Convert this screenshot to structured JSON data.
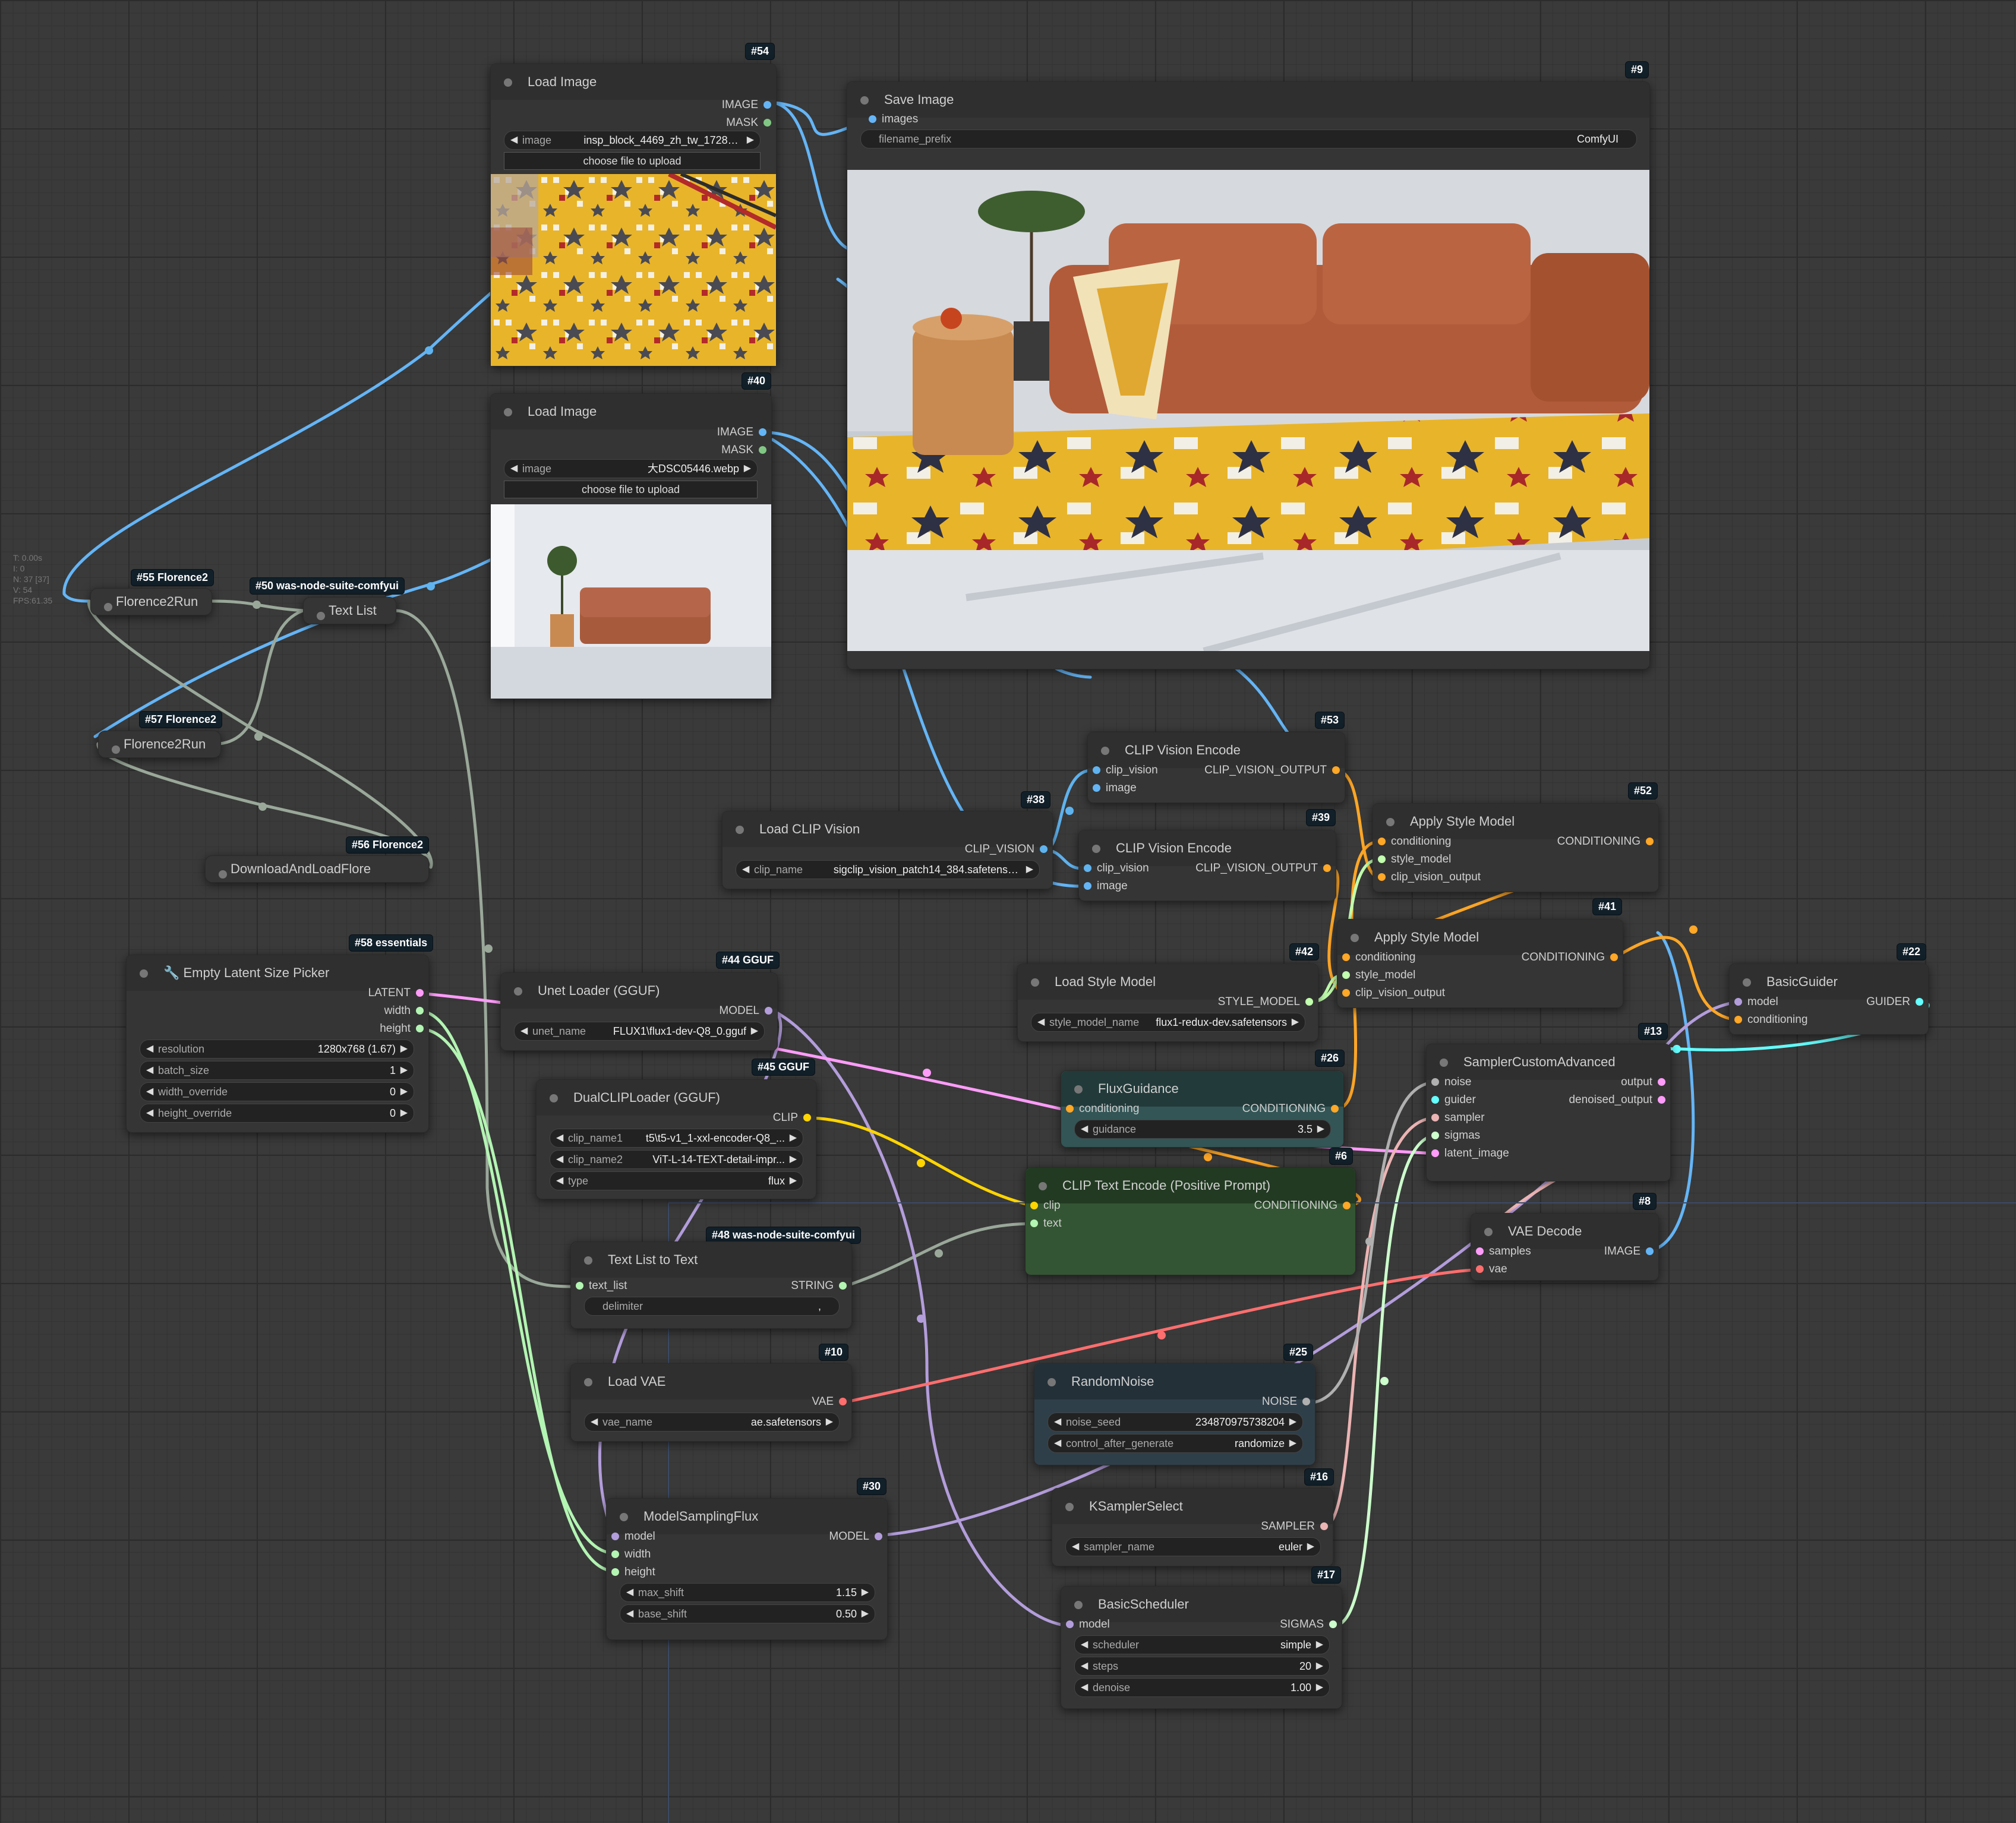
{
  "colors": {
    "clip_vision": "#5fb3ef",
    "image": "#64b5f6",
    "model": "#b39ddb",
    "conditioning": "#ffa726",
    "latent": "#ff9cf9",
    "vae": "#ff6e6e",
    "clip": "#ffd500",
    "int": "#b3f5b3",
    "string": "#9aa89a",
    "guider": "#66ffff",
    "sampler": "#ecb4b4",
    "sigmas": "#cdffcd",
    "noise": "#b0b0b0",
    "style_model": "#c2ffae",
    "mask": "#81c784"
  },
  "stats": [
    "T: 0.00s",
    "I: 0",
    "N: 37 [37]",
    "V: 54",
    "FPS:61.35"
  ],
  "nodes": {
    "load_image_54": {
      "badge": "#54",
      "title": "Load Image",
      "out_image": "IMAGE",
      "out_mask": "MASK",
      "widget_label": "image",
      "widget_value": "insp_block_4469_zh_tw_1728358...",
      "upload": "choose file to upload"
    },
    "load_image_40": {
      "badge": "#40",
      "title": "Load Image",
      "out_image": "IMAGE",
      "out_mask": "MASK",
      "widget_label": "image",
      "widget_value": "大DSC05446.webp",
      "upload": "choose file to upload"
    },
    "save_image_9": {
      "badge": "#9",
      "title": "Save Image",
      "in_images": "images",
      "widget_label": "filename_prefix",
      "widget_value": "ComfyUI"
    },
    "florence_55": {
      "badge": "#55 Florence2",
      "title": "Florence2Run"
    },
    "text_list_50": {
      "badge": "#50 was-node-suite-comfyui",
      "title": "Text List"
    },
    "florence_57": {
      "badge": "#57 Florence2",
      "title": "Florence2Run"
    },
    "download_56": {
      "badge": "#56 Florence2",
      "title": "DownloadAndLoadFlore"
    },
    "empty_latent_58": {
      "badge": "#58 essentials",
      "title": "🔧 Empty Latent Size Picker",
      "out_latent": "LATENT",
      "out_width": "width",
      "out_height": "height",
      "widgets": [
        {
          "label": "resolution",
          "value": "1280x768 (1.67)"
        },
        {
          "label": "batch_size",
          "value": "1"
        },
        {
          "label": "width_override",
          "value": "0"
        },
        {
          "label": "height_override",
          "value": "0"
        }
      ]
    },
    "unet_44": {
      "badge": "#44 GGUF",
      "title": "Unet Loader (GGUF)",
      "out_model": "MODEL",
      "widget_label": "unet_name",
      "widget_value": "FLUX1\\flux1-dev-Q8_0.gguf"
    },
    "dualclip_45": {
      "badge": "#45 GGUF",
      "title": "DualCLIPLoader (GGUF)",
      "out_clip": "CLIP",
      "widgets": [
        {
          "label": "clip_name1",
          "value": "t5\\t5-v1_1-xxl-encoder-Q8_..."
        },
        {
          "label": "clip_name2",
          "value": "ViT-L-14-TEXT-detail-impr..."
        },
        {
          "label": "type",
          "value": "flux"
        }
      ]
    },
    "text_list_to_text_48": {
      "badge": "#48 was-node-suite-comfyui",
      "title": "Text List to Text",
      "in_text_list": "text_list",
      "out_string": "STRING",
      "widget_label": "delimiter",
      "widget_value": ","
    },
    "load_vae_10": {
      "badge": "#10",
      "title": "Load VAE",
      "out_vae": "VAE",
      "widget_label": "vae_name",
      "widget_value": "ae.safetensors"
    },
    "model_sampling_30": {
      "badge": "#30",
      "title": "ModelSamplingFlux",
      "in_model": "model",
      "in_width": "width",
      "in_height": "height",
      "out_model": "MODEL",
      "widgets": [
        {
          "label": "max_shift",
          "value": "1.15"
        },
        {
          "label": "base_shift",
          "value": "0.50"
        }
      ]
    },
    "load_clip_vision_38": {
      "badge": "#38",
      "title": "Load CLIP Vision",
      "out_clip_vision": "CLIP_VISION",
      "widget_label": "clip_name",
      "widget_value": "sigclip_vision_patch14_384.safetensors"
    },
    "clip_vision_53": {
      "badge": "#53",
      "title": "CLIP Vision Encode",
      "in_clip_vision": "clip_vision",
      "in_image": "image",
      "out": "CLIP_VISION_OUTPUT"
    },
    "clip_vision_39": {
      "badge": "#39",
      "title": "CLIP Vision Encode",
      "in_clip_vision": "clip_vision",
      "in_image": "image",
      "out": "CLIP_VISION_OUTPUT"
    },
    "load_style_42": {
      "badge": "#42",
      "title": "Load Style Model",
      "out_style": "STYLE_MODEL",
      "widget_label": "style_model_name",
      "widget_value": "flux1-redux-dev.safetensors"
    },
    "flux_guidance_26": {
      "badge": "#26",
      "title": "FluxGuidance",
      "in_conditioning": "conditioning",
      "out_conditioning": "CONDITIONING",
      "widget_label": "guidance",
      "widget_value": "3.5"
    },
    "clip_text_6": {
      "badge": "#6",
      "title": "CLIP Text Encode (Positive Prompt)",
      "in_clip": "clip",
      "in_text": "text",
      "out_conditioning": "CONDITIONING"
    },
    "random_noise_25": {
      "badge": "#25",
      "title": "RandomNoise",
      "out_noise": "NOISE",
      "widgets": [
        {
          "label": "noise_seed",
          "value": "234870975738204"
        },
        {
          "label": "control_after_generate",
          "value": "randomize"
        }
      ]
    },
    "ksampler_select_16": {
      "badge": "#16",
      "title": "KSamplerSelect",
      "out_sampler": "SAMPLER",
      "widget_label": "sampler_name",
      "widget_value": "euler"
    },
    "basic_scheduler_17": {
      "badge": "#17",
      "title": "BasicScheduler",
      "in_model": "model",
      "out_sigmas": "SIGMAS",
      "widgets": [
        {
          "label": "scheduler",
          "value": "simple"
        },
        {
          "label": "steps",
          "value": "20"
        },
        {
          "label": "denoise",
          "value": "1.00"
        }
      ]
    },
    "apply_style_52": {
      "badge": "#52",
      "title": "Apply Style Model",
      "in_conditioning": "conditioning",
      "in_style_model": "style_model",
      "in_clip_vision_output": "clip_vision_output",
      "out_conditioning": "CONDITIONING"
    },
    "apply_style_41": {
      "badge": "#41",
      "title": "Apply Style Model",
      "in_conditioning": "conditioning",
      "in_style_model": "style_model",
      "in_clip_vision_output": "clip_vision_output",
      "out_conditioning": "CONDITIONING"
    },
    "basic_guider_22": {
      "badge": "#22",
      "title": "BasicGuider",
      "in_model": "model",
      "in_conditioning": "conditioning",
      "out_guider": "GUIDER"
    },
    "sampler_custom_13": {
      "badge": "#13",
      "title": "SamplerCustomAdvanced",
      "in_noise": "noise",
      "in_guider": "guider",
      "in_sampler": "sampler",
      "in_sigmas": "sigmas",
      "in_latent": "latent_image",
      "out_output": "output",
      "out_denoised": "denoised_output"
    },
    "vae_decode_8": {
      "badge": "#8",
      "title": "VAE Decode",
      "in_samples": "samples",
      "in_vae": "vae",
      "out_image": "IMAGE"
    }
  }
}
